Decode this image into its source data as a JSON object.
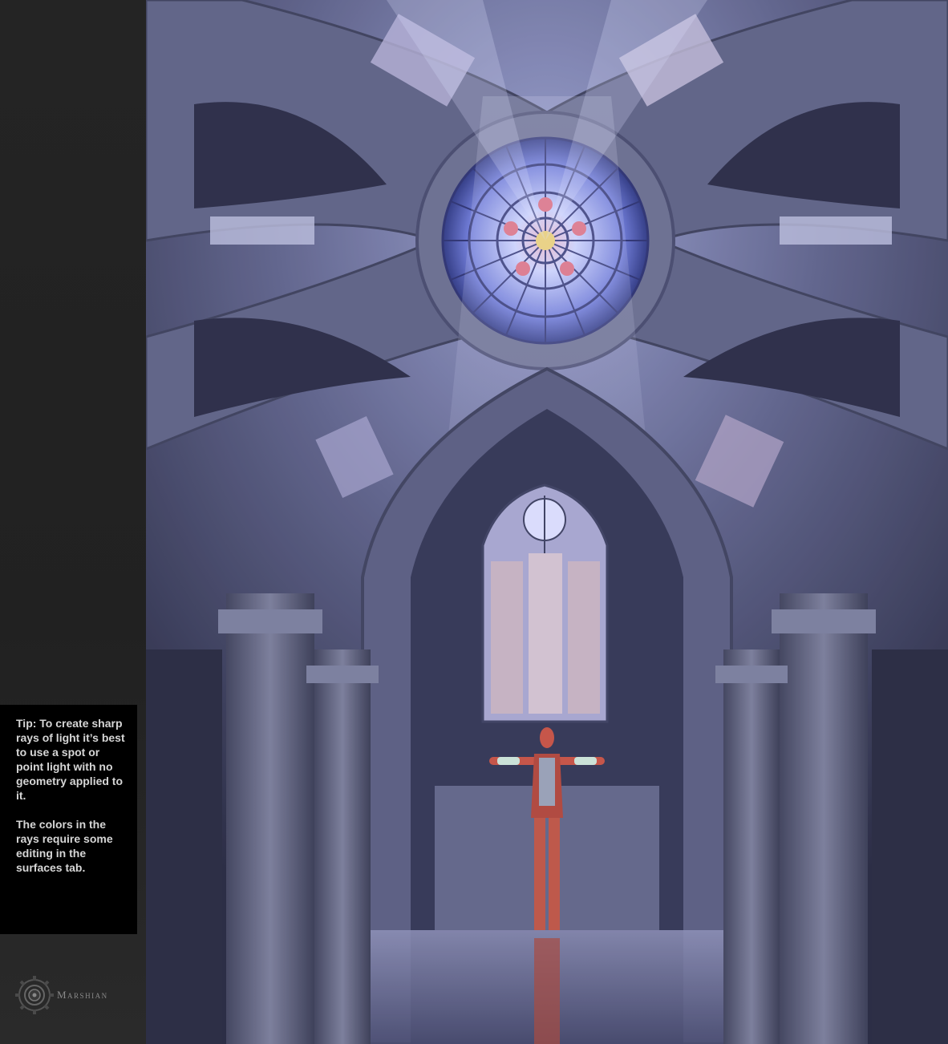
{
  "tip": {
    "paragraph1": "Tip: To create sharp rays of light it’s best to use a spot or point light with no geometry applied to it.",
    "paragraph2": "The colors in the rays require some editing in the surfaces tab."
  },
  "logo": {
    "text": "Marshian"
  },
  "scene": {
    "subject": "cathedral-interior-render",
    "icon": "rose-window"
  },
  "colors": {
    "sidebar": "#222222",
    "tip_background": "#000000",
    "tip_text": "#d6d6d6",
    "stone": "#6e7290",
    "light": "#c9cdf0"
  }
}
